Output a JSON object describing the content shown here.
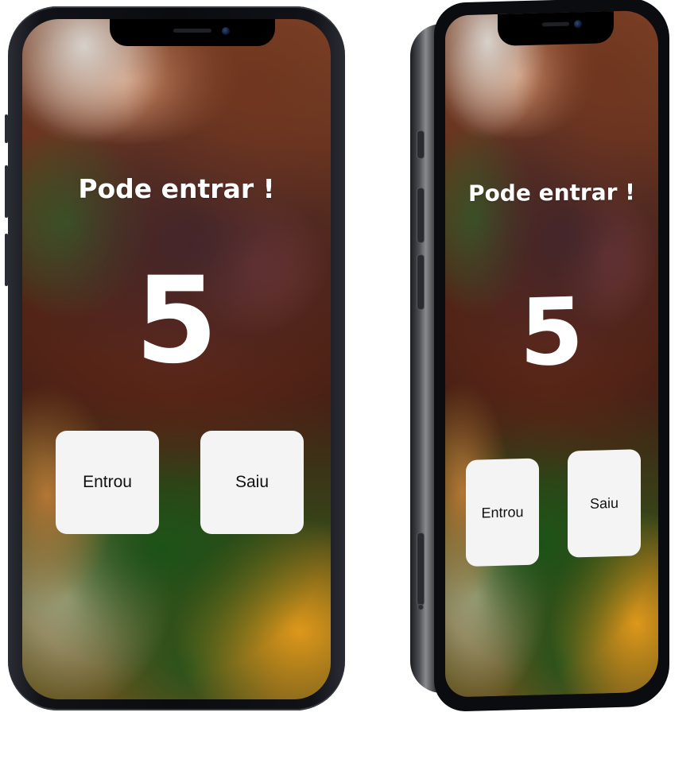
{
  "app": {
    "title": "Pode entrar !",
    "counter": "5",
    "buttons": {
      "entered_label": "Entrou",
      "left_label": "Saiu"
    }
  },
  "mockups": [
    {
      "view": "front"
    },
    {
      "view": "angled"
    }
  ]
}
